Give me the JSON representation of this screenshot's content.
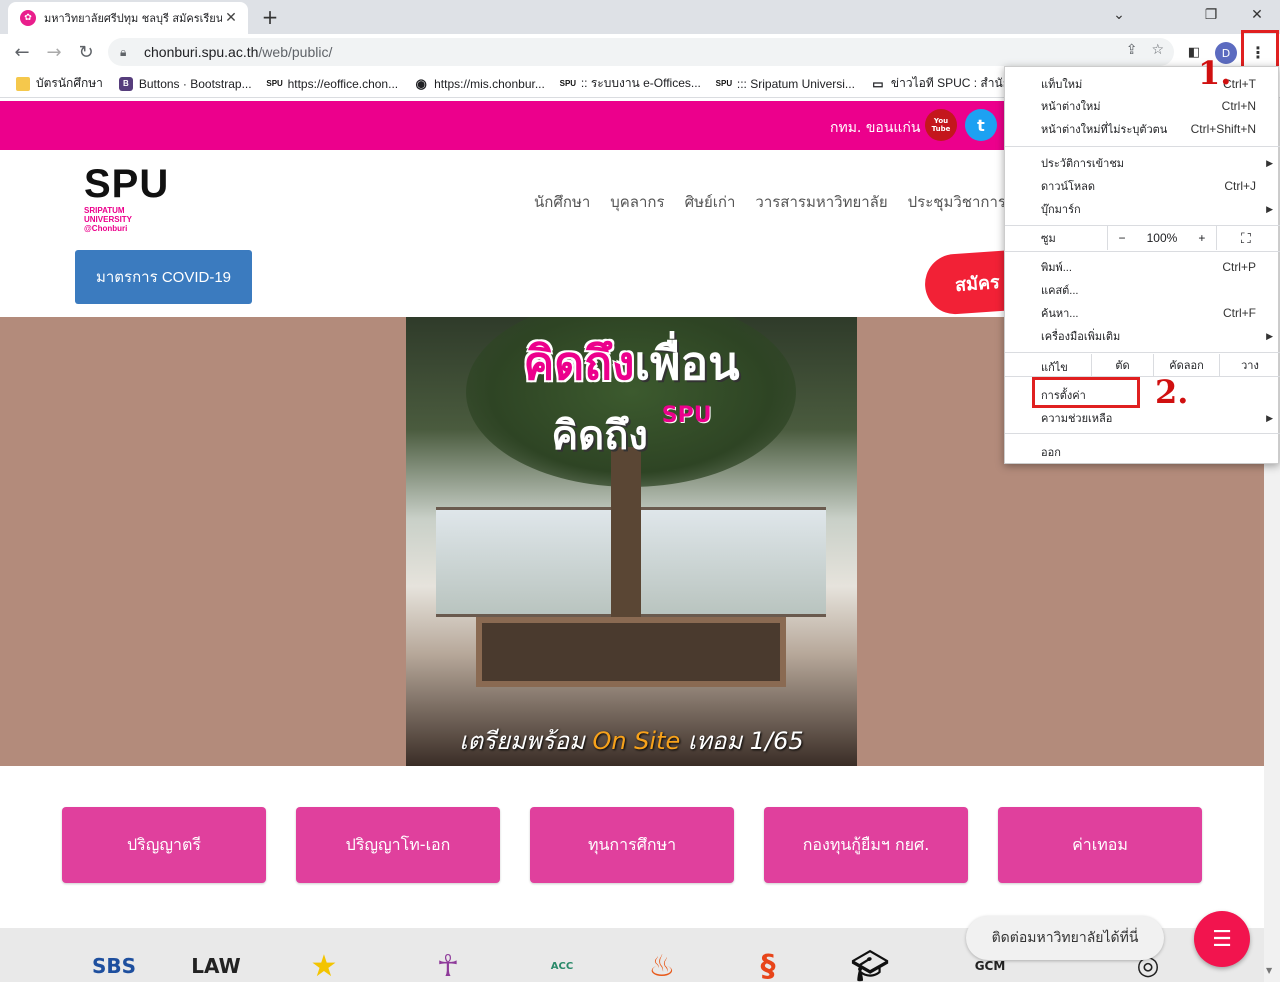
{
  "browser": {
    "tab_title": "มหาวิทยาลัยศรีปทุม ชลบุรี สมัครเรียน ป",
    "tab_close": "✕",
    "new_tab": "+",
    "url_host": "chonburi.spu.ac.th",
    "url_path": "/web/public/",
    "profile_initial": "D",
    "bookmarks": [
      {
        "label": "บัตรนักศึกษา",
        "icon": "folder-icon"
      },
      {
        "label": "Buttons · Bootstrap...",
        "icon": "bootstrap-icon"
      },
      {
        "label": "https://eoffice.chon...",
        "icon": "spu-icon"
      },
      {
        "label": "https://mis.chonbur...",
        "icon": "globe-icon"
      },
      {
        "label": ":: ระบบงาน e-Offices...",
        "icon": "spu-icon"
      },
      {
        "label": "::: Sripatum Universi...",
        "icon": "spu-icon"
      },
      {
        "label": "ข่าวไอที SPUC : สำนัก...",
        "icon": "monitor-icon"
      }
    ]
  },
  "site": {
    "topbar": {
      "campuses": "กทม.  ขอนแก่น",
      "youtube": "You Tube",
      "twitter": "t"
    },
    "logo": {
      "main": "SPU",
      "line1": "SRIPATUM",
      "line2": "UNIVERSITY",
      "line3": "@Chonburi"
    },
    "nav": [
      "นักศึกษา",
      "บุคลากร",
      "ศิษย์เก่า",
      "วารสารมหาวิทยาลัย",
      "ประชุมวิชาการ"
    ],
    "covid_button": "มาตรการ COVID-19",
    "apply_button": "สมัคร",
    "hero": {
      "line1_pink": "คิดถึง",
      "line1_white": "เพื่อน",
      "line2": "คิดถึง",
      "line2_logo": "SPU",
      "bottom_prefix": "เตรียมพร้อม ",
      "bottom_highlight": "On Site",
      "bottom_suffix": " เทอม 1/65"
    },
    "cards": [
      "ปริญญาตรี",
      "ปริญญาโท-เอก",
      "ทุนการศึกษา",
      "กองทุนกู้ยืมฯ กยศ.",
      "ค่าเทอม"
    ],
    "footer_logos": [
      "SBS",
      "LAW",
      "ACC",
      "GCM"
    ],
    "chat_text": "ติดต่อมหาวิทยาลัยได้ที่นี่"
  },
  "menu": {
    "items_top": [
      {
        "label": "แท็บใหม่",
        "shortcut": "Ctrl+T"
      },
      {
        "label": "หน้าต่างใหม่",
        "shortcut": "Ctrl+N"
      },
      {
        "label": "หน้าต่างใหม่ที่ไม่ระบุตัวตน",
        "shortcut": "Ctrl+Shift+N"
      }
    ],
    "items_mid": [
      {
        "label": "ประวัติการเข้าชม",
        "shortcut": ""
      },
      {
        "label": "ดาวน์โหลด",
        "shortcut": "Ctrl+J"
      },
      {
        "label": "บุ๊กมาร์ก",
        "shortcut": ""
      }
    ],
    "zoom": {
      "label": "ซูม",
      "minus": "−",
      "value": "100%",
      "plus": "+"
    },
    "items_tools": [
      {
        "label": "พิมพ์...",
        "shortcut": "Ctrl+P"
      },
      {
        "label": "แคสต์...",
        "shortcut": ""
      },
      {
        "label": "ค้นหา...",
        "shortcut": "Ctrl+F"
      },
      {
        "label": "เครื่องมือเพิ่มเติม",
        "shortcut": ""
      }
    ],
    "edit": {
      "label": "แก้ไข",
      "cut": "ตัด",
      "copy": "คัดลอก",
      "paste": "วาง"
    },
    "settings": "การตั้งค่า",
    "help": "ความช่วยเหลือ",
    "exit": "ออก"
  },
  "annotations": {
    "step1": "1.",
    "step2": "2."
  }
}
